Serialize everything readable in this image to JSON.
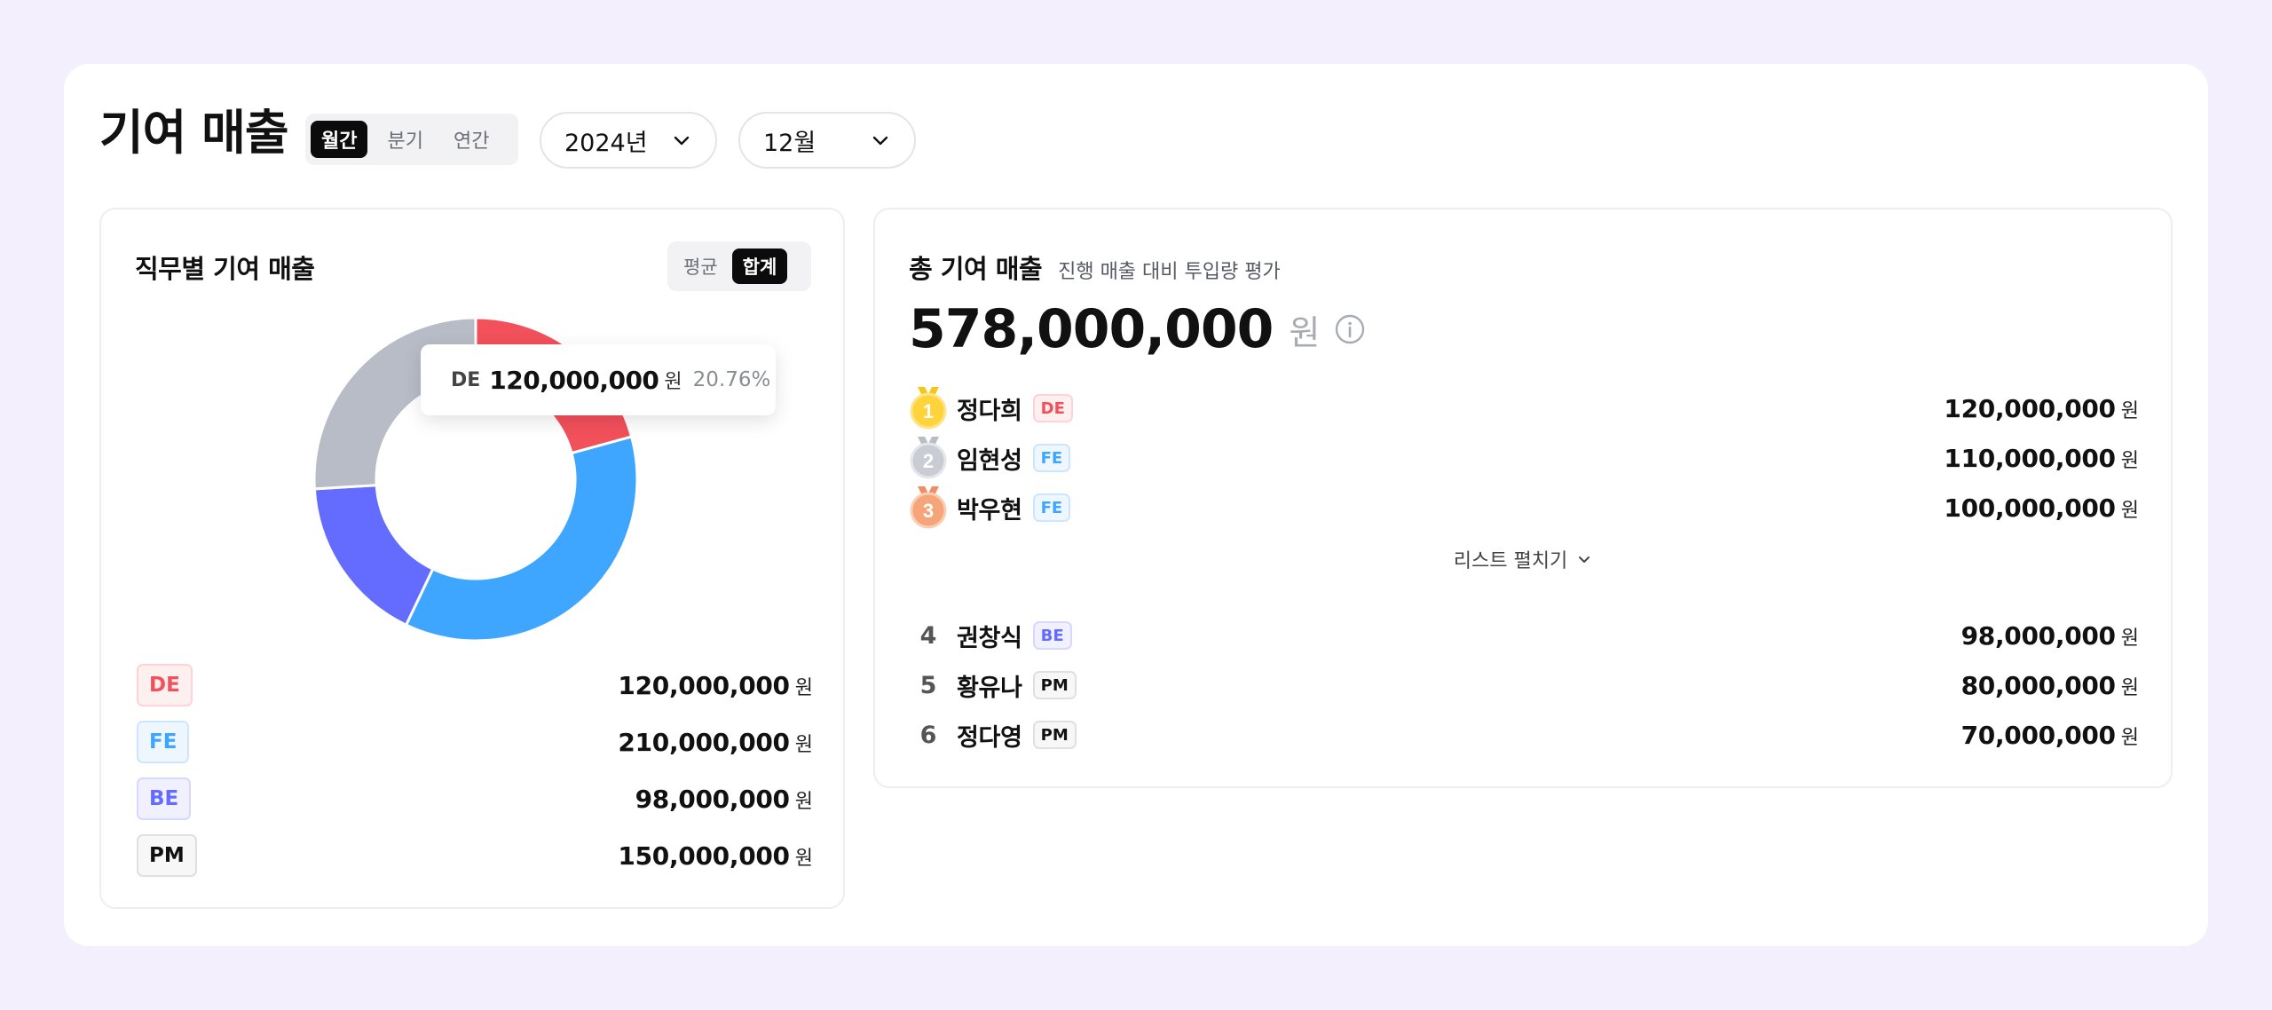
{
  "header": {
    "title": "기여 매출",
    "period_tabs": [
      "월간",
      "분기",
      "연간"
    ],
    "active_period": "월간",
    "year": "2024년",
    "month": "12월"
  },
  "left": {
    "title": "직무별 기여 매출",
    "mode_tabs": [
      "평균",
      "합계"
    ],
    "active_mode": "합계",
    "tooltip": {
      "label": "DE",
      "value": "120,000,000",
      "unit": "원",
      "percent": "20.76%"
    },
    "legend": [
      {
        "code": "DE",
        "value": "120,000,000",
        "unit": "원",
        "color": "#f2505a"
      },
      {
        "code": "FE",
        "value": "210,000,000",
        "unit": "원",
        "color": "#3ea6ff"
      },
      {
        "code": "BE",
        "value": "98,000,000",
        "unit": "원",
        "color": "#646cff"
      },
      {
        "code": "PM",
        "value": "150,000,000",
        "unit": "원",
        "color": "#b8bcc6"
      }
    ]
  },
  "chart_data": {
    "type": "pie",
    "categories": [
      "DE",
      "FE",
      "BE",
      "PM"
    ],
    "values": [
      120000000,
      210000000,
      98000000,
      150000000
    ],
    "colors": [
      "#f2505a",
      "#3ea6ff",
      "#646cff",
      "#b8bcc6"
    ],
    "donut": true
  },
  "right": {
    "title": "총 기여 매출",
    "subtitle": "진행 매출 대비 투입량 평가",
    "total": "578,000,000",
    "total_unit": "원",
    "top": [
      {
        "rank": "1",
        "name": "정다희",
        "role": "DE",
        "value": "120,000,000",
        "unit": "원",
        "medal_color": "#ffd43b"
      },
      {
        "rank": "2",
        "name": "임현성",
        "role": "FE",
        "value": "110,000,000",
        "unit": "원",
        "medal_color": "#c9ccd3"
      },
      {
        "rank": "3",
        "name": "박우현",
        "role": "FE",
        "value": "100,000,000",
        "unit": "원",
        "medal_color": "#f6a57b"
      }
    ],
    "expand_label": "리스트 펼치기",
    "rest": [
      {
        "rank": "4",
        "name": "권창식",
        "role": "BE",
        "value": "98,000,000",
        "unit": "원"
      },
      {
        "rank": "5",
        "name": "황유나",
        "role": "PM",
        "value": "80,000,000",
        "unit": "원"
      },
      {
        "rank": "6",
        "name": "정다영",
        "role": "PM",
        "value": "70,000,000",
        "unit": "원"
      }
    ]
  }
}
